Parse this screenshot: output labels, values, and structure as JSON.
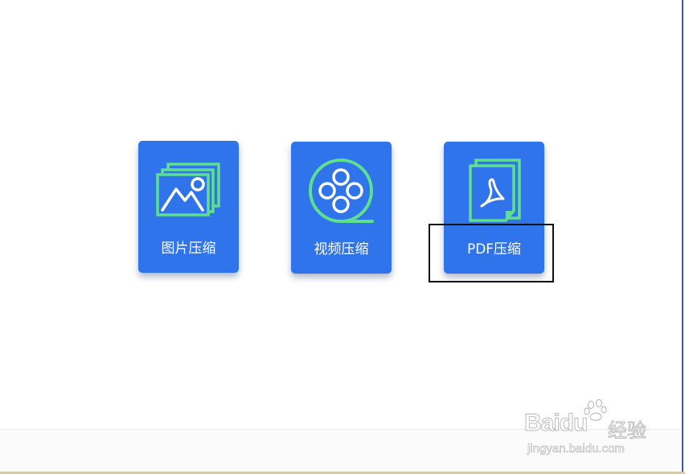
{
  "tools": [
    {
      "label": "图片压缩",
      "icon": "image-stack-icon"
    },
    {
      "label": "视频压缩",
      "icon": "film-reel-icon"
    },
    {
      "label": "PDF压缩",
      "icon": "pdf-document-icon"
    }
  ],
  "watermark": {
    "brand": "Baidu",
    "suffix": "经验",
    "url": "jingyan.baidu.com"
  },
  "colors": {
    "card_background": "#2f74ea",
    "icon_accent": "#5fe08f",
    "label_text": "#ffffff",
    "highlight_box": "#111111"
  }
}
